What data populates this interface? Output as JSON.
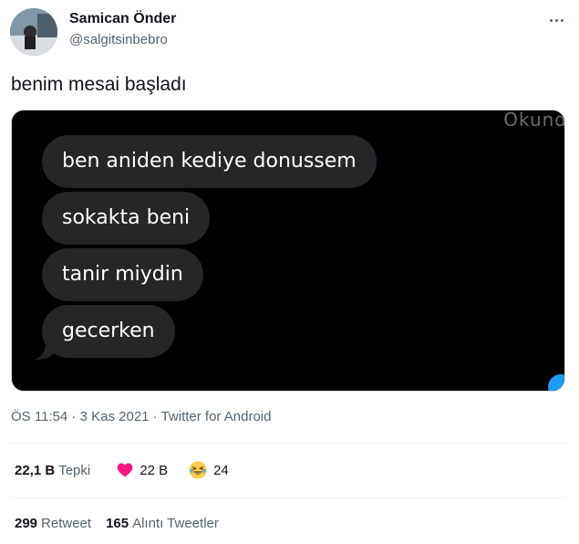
{
  "author": {
    "display_name": "Samican Önder",
    "handle": "@salgitsinbebro"
  },
  "tweet": {
    "text": "benim mesai başladı"
  },
  "media": {
    "partial_text": "Okund",
    "bubbles": [
      "ben aniden kediye donussem",
      "sokakta beni",
      "tanir miydin",
      "gecerken"
    ]
  },
  "meta": {
    "time": "ÖS 11:54",
    "sep1": " · ",
    "date": "3 Kas 2021",
    "sep2": " · ",
    "source": "Twitter for Android"
  },
  "reactions": {
    "total_count": "22,1 B",
    "total_label": "Tepki",
    "heart_count": "22 B",
    "laugh_count": "24"
  },
  "shares": {
    "retweet_count": "299",
    "retweet_label": "Retweet",
    "quote_count": "165",
    "quote_label": "Alıntı Tweetler"
  },
  "colors": {
    "text": "#0f1419",
    "secondary": "#536471",
    "heart": "#f91880",
    "bubble": "#262628"
  }
}
